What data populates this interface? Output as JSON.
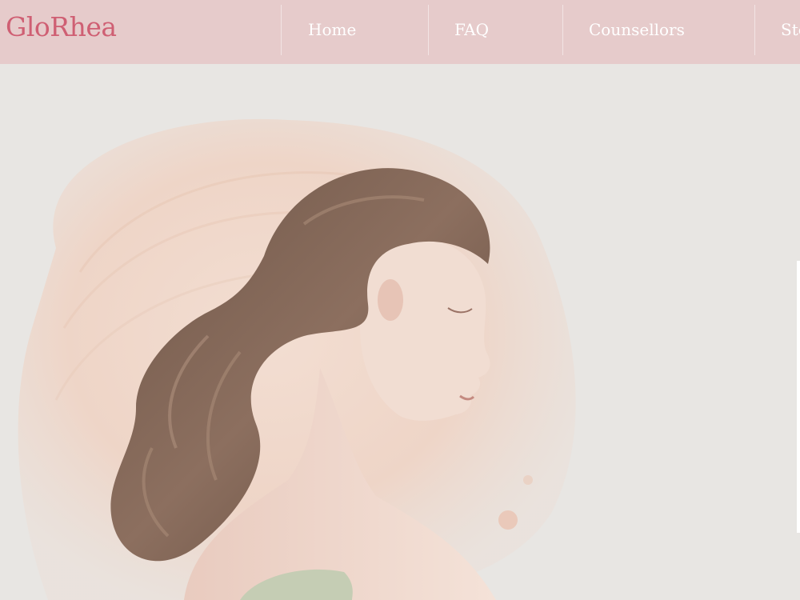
{
  "brand": {
    "name": "GloRhea",
    "color": "#cf5f73"
  },
  "nav": {
    "items": [
      {
        "label": "Home"
      },
      {
        "label": "FAQ"
      },
      {
        "label": "Counsellors"
      },
      {
        "label": "Sto"
      }
    ],
    "background": "#e6cbcb"
  },
  "hero": {
    "image": "woman-profile-illustration",
    "background": "#e8e6e3"
  }
}
